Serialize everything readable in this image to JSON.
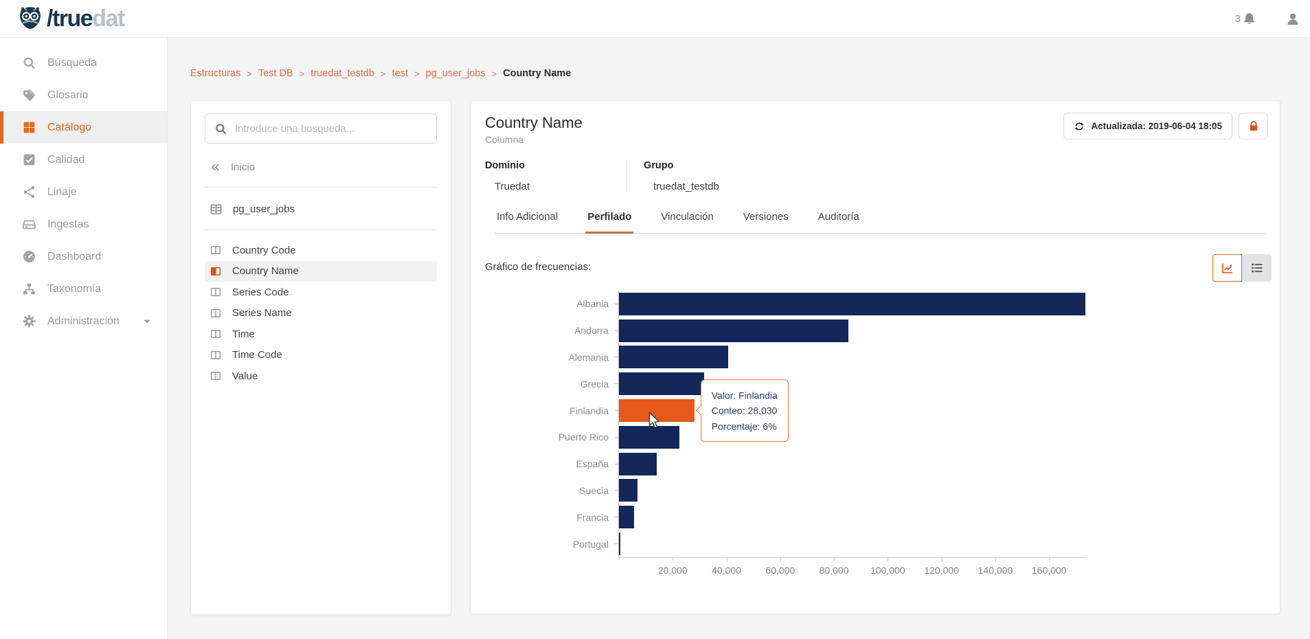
{
  "topbar": {
    "logo": {
      "slash_true": "/true",
      "dat": "dat"
    },
    "notifications": {
      "count": "3"
    }
  },
  "sidebar": {
    "items": [
      {
        "label": "Búsqueda",
        "icon": "search",
        "active": false
      },
      {
        "label": "Glosario",
        "icon": "tags",
        "active": false
      },
      {
        "label": "Catálogo",
        "icon": "grid",
        "active": true
      },
      {
        "label": "Calidad",
        "icon": "check-square",
        "active": false
      },
      {
        "label": "Linaje",
        "icon": "share",
        "active": false
      },
      {
        "label": "Ingestas",
        "icon": "inbox",
        "active": false
      },
      {
        "label": "Dashboard",
        "icon": "gauge",
        "active": false
      },
      {
        "label": "Taxonomía",
        "icon": "sitemap",
        "active": false
      },
      {
        "label": "Administración",
        "icon": "gear",
        "active": false,
        "chevron": true
      }
    ]
  },
  "breadcrumb": {
    "links": [
      "Estructuras",
      "Test DB",
      "truedat_testdb",
      "test",
      "pg_user_jobs"
    ],
    "separator": ">",
    "current": "Country Name"
  },
  "explorer": {
    "search_placeholder": "Introduce una busqueda...",
    "back_label": "Inicio",
    "table_label": "pg_user_jobs",
    "columns": [
      {
        "label": "Country Code",
        "active": false
      },
      {
        "label": "Country Name",
        "active": true
      },
      {
        "label": "Series Code",
        "active": false
      },
      {
        "label": "Series Name",
        "active": false
      },
      {
        "label": "Time",
        "active": false
      },
      {
        "label": "Time Code",
        "active": false
      },
      {
        "label": "Value",
        "active": false
      }
    ]
  },
  "main": {
    "title": "Country Name",
    "subtitle": "Columna",
    "updated_label": "Actualizada: 2019-06-04 18:05",
    "domain": {
      "label": "Dominio",
      "value": "Truedat"
    },
    "group": {
      "label": "Grupo",
      "value": "truedat_testdb"
    },
    "tabs": [
      {
        "label": "Info Adicional",
        "active": false
      },
      {
        "label": "Perfilado",
        "active": true
      },
      {
        "label": "Vinculación",
        "active": false
      },
      {
        "label": "Versiones",
        "active": false
      },
      {
        "label": "Auditoría",
        "active": false
      }
    ],
    "section_title": "Gráfico de frecuencias:"
  },
  "chart_data": {
    "type": "bar",
    "orientation": "horizontal",
    "title": "Gráfico de frecuencias:",
    "categories": [
      "Albania",
      "Andorra",
      "Alemania",
      "Grecia",
      "Finlandia",
      "Puerto Rico",
      "España",
      "Suecia",
      "Francia",
      "Portugal"
    ],
    "values": [
      173000,
      85000,
      40500,
      31500,
      28030,
      22500,
      14000,
      7000,
      5600,
      400
    ],
    "xlim": [
      0,
      174000
    ],
    "xticks": [
      20000,
      40000,
      60000,
      80000,
      100000,
      120000,
      140000,
      160000
    ],
    "xtick_labels": [
      "20,000",
      "40,000",
      "60,000",
      "80,000",
      "100,000",
      "120,000",
      "140,000",
      "160,000"
    ],
    "bar_color": "#14275a",
    "highlight_color": "#e5591d",
    "grid": false,
    "highlight": {
      "index": 4,
      "category": "Finlandia",
      "count": "28,030",
      "percent": "6%"
    },
    "tooltip": {
      "value_line": "Valor: Finlandia",
      "count_line": "Conteo: 28,030",
      "percent_line": "Porcentaje: 6%"
    }
  },
  "colors": {
    "accent": "#e8671f",
    "bar": "#14275a",
    "bar_highlight": "#e5591d",
    "breadcrumb_link": "#dd6b44",
    "tab_underline": "#c9713a"
  }
}
